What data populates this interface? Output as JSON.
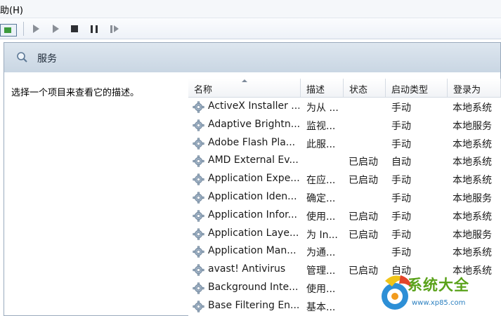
{
  "menu": {
    "help": "助(H)"
  },
  "panel": {
    "title": "服务",
    "description": "选择一个项目来查看它的描述。"
  },
  "columns": [
    "名称",
    "描述",
    "状态",
    "启动类型",
    "登录为"
  ],
  "rows": [
    {
      "name": "ActiveX Installer ...",
      "desc": "为从 ...",
      "status": "",
      "startup": "手动",
      "logon": "本地系统"
    },
    {
      "name": "Adaptive Brightn...",
      "desc": "监视...",
      "status": "",
      "startup": "手动",
      "logon": "本地服务"
    },
    {
      "name": "Adobe Flash Pla...",
      "desc": "此服...",
      "status": "",
      "startup": "手动",
      "logon": "本地系统"
    },
    {
      "name": "AMD External Ev...",
      "desc": "",
      "status": "已启动",
      "startup": "自动",
      "logon": "本地系统"
    },
    {
      "name": "Application Expe...",
      "desc": "在应...",
      "status": "已启动",
      "startup": "手动",
      "logon": "本地系统"
    },
    {
      "name": "Application Iden...",
      "desc": "确定...",
      "status": "",
      "startup": "手动",
      "logon": "本地服务"
    },
    {
      "name": "Application Infor...",
      "desc": "使用...",
      "status": "已启动",
      "startup": "手动",
      "logon": "本地系统"
    },
    {
      "name": "Application Laye...",
      "desc": "为 In...",
      "status": "已启动",
      "startup": "手动",
      "logon": "本地服务"
    },
    {
      "name": "Application Man...",
      "desc": "为通...",
      "status": "",
      "startup": "手动",
      "logon": "本地系统"
    },
    {
      "name": "avast! Antivirus",
      "desc": "管理...",
      "status": "已启动",
      "startup": "自动",
      "logon": "本地系统"
    },
    {
      "name": "Background Inte...",
      "desc": "使用...",
      "status": "",
      "startup": "",
      "logon": ""
    },
    {
      "name": "Base Filtering En...",
      "desc": "基本...",
      "status": "",
      "startup": "",
      "logon": ""
    }
  ],
  "watermark": {
    "title": "系统大全",
    "url": "www.xp85.com"
  },
  "colors": {
    "header_bg": "#c9d6e3",
    "watermark_green": "#5aa21a",
    "watermark_blue": "#2a7fc0"
  }
}
